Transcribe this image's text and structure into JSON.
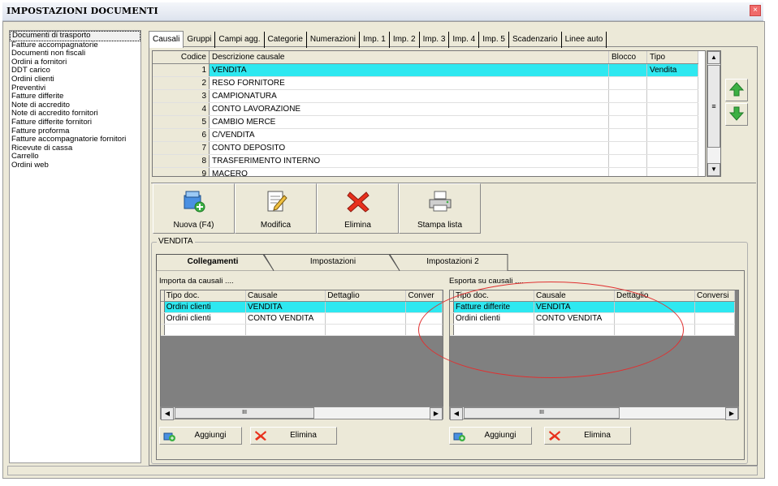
{
  "window": {
    "title": "IMPOSTAZIONI DOCUMENTI",
    "close_label": "×"
  },
  "doc_list": [
    "Documenti di trasporto",
    "Fatture accompagnatorie",
    "Documenti non fiscali",
    "Ordini a fornitori",
    "DDT carico",
    "Ordini clienti",
    "Preventivi",
    "Fatture differite",
    "Note di accredito",
    "Note di accredito fornitori",
    "Fatture differite fornitori",
    "Fatture proforma",
    "Fatture accompagnatorie fornitori",
    "Ricevute di cassa",
    "Carrello",
    "Ordini web"
  ],
  "main_tabs": [
    "Causali",
    "Gruppi",
    "Campi agg.",
    "Categorie",
    "Numerazioni",
    "Imp. 1",
    "Imp. 2",
    "Imp. 3",
    "Imp. 4",
    "Imp. 5",
    "Scadenzario",
    "Linee auto"
  ],
  "causali_grid": {
    "headers": [
      "Codice",
      "Descrizione causale",
      "Blocco",
      "Tipo"
    ],
    "rows": [
      [
        "1",
        "VENDITA",
        "",
        "Vendita"
      ],
      [
        "2",
        "RESO FORNITORE",
        "",
        ""
      ],
      [
        "3",
        "CAMPIONATURA",
        "",
        ""
      ],
      [
        "4",
        "CONTO LAVORAZIONE",
        "",
        ""
      ],
      [
        "5",
        "CAMBIO MERCE",
        "",
        ""
      ],
      [
        "6",
        "C/VENDITA",
        "",
        ""
      ],
      [
        "7",
        "CONTO DEPOSITO",
        "",
        ""
      ],
      [
        "8",
        "TRASFERIMENTO INTERNO",
        "",
        ""
      ],
      [
        "9",
        "MACERO",
        "",
        ""
      ]
    ]
  },
  "toolbar": {
    "new_label": "Nuova (F4)",
    "edit_label": "Modifica",
    "delete_label": "Elimina",
    "print_label": "Stampa lista"
  },
  "group": {
    "title": "VENDITA",
    "tabs": [
      "Collegamenti",
      "Impostazioni",
      "Impostazioni 2"
    ]
  },
  "import_grid": {
    "label": "Importa da causali ....",
    "headers": [
      "Tipo doc.",
      "Causale",
      "Dettaglio",
      "Conver"
    ],
    "rows": [
      [
        "Ordini clienti",
        "VENDITA",
        "",
        ""
      ],
      [
        "Ordini clienti",
        "CONTO VENDITA",
        "",
        ""
      ]
    ],
    "add_label": "Aggiungi",
    "delete_label": "Elimina"
  },
  "export_grid": {
    "label": "Esporta su causali ....",
    "headers": [
      "Tipo doc.",
      "Causale",
      "Dettaglio",
      "Conversi"
    ],
    "rows": [
      [
        "Fatture differite",
        "VENDITA",
        "",
        ""
      ],
      [
        "Ordini clienti",
        "CONTO VENDITA",
        "",
        ""
      ]
    ],
    "add_label": "Aggiungi",
    "delete_label": "Elimina"
  },
  "scroll_glyphs": {
    "up": "▲",
    "down": "▼",
    "left": "◀",
    "right": "▶",
    "grip": "≡",
    "hgrip": "III"
  },
  "colors": {
    "selection": "#2ee8f0",
    "annotation": "#e03030",
    "arrow": "#3cb043"
  }
}
